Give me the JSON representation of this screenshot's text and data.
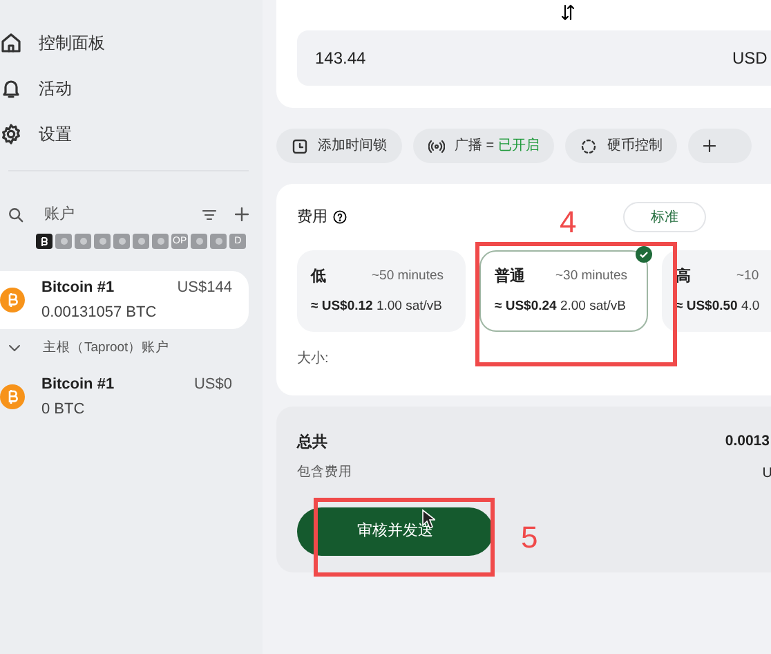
{
  "sidebar": {
    "nav": [
      {
        "kind": "home",
        "label": "控制面板"
      },
      {
        "kind": "bell",
        "label": "活动"
      },
      {
        "kind": "gear",
        "label": "设置"
      }
    ],
    "accounts_header": {
      "label": "账户"
    },
    "chains": [
      {
        "selected": true,
        "kind": "bitcoin"
      },
      {
        "selected": false,
        "kind": "blank"
      },
      {
        "selected": false,
        "kind": "blank"
      },
      {
        "selected": false,
        "kind": "blank"
      },
      {
        "selected": false,
        "kind": "blank"
      },
      {
        "selected": false,
        "kind": "blank"
      },
      {
        "selected": false,
        "kind": "blank"
      },
      {
        "selected": false,
        "kind": "text",
        "label": "OP"
      },
      {
        "selected": false,
        "kind": "blank"
      },
      {
        "selected": false,
        "kind": "blank"
      },
      {
        "selected": false,
        "kind": "text",
        "label": "D"
      }
    ],
    "accounts": [
      {
        "name": "Bitcoin #1",
        "fiat": "US$144",
        "amount": "0.00131057 BTC",
        "selected": true
      }
    ],
    "group": {
      "label": "主根（Taproot）账户",
      "expanded": true,
      "accounts": [
        {
          "name": "Bitcoin #1",
          "fiat": "US$0",
          "amount": "0 BTC",
          "selected": false
        }
      ]
    }
  },
  "amount": {
    "value": "143.44",
    "currency": "USD"
  },
  "chips": [
    {
      "kind": "timelock",
      "label": "添加时间锁"
    },
    {
      "kind": "broadcast",
      "label": "广播 =",
      "value": "已开启"
    },
    {
      "kind": "coins",
      "label": "硬币控制"
    },
    {
      "kind": "plus"
    }
  ],
  "fee": {
    "title": "费用",
    "mode": "标准",
    "options": [
      {
        "label": "低",
        "eta": "~50 minutes",
        "price": "≈ US$0.12",
        "rate": "1.00 sat/vB",
        "selected": false
      },
      {
        "label": "普通",
        "eta": "~30 minutes",
        "price": "≈ US$0.24",
        "rate": "2.00 sat/vB",
        "selected": true
      },
      {
        "label": "高",
        "eta": "~10",
        "price": "≈ US$0.50",
        "rate": "4.0",
        "selected": false
      }
    ],
    "size_label": "大小:"
  },
  "total": {
    "label": "总共",
    "value": "0.0013",
    "sub_label": "包含费用",
    "sub_value": "U"
  },
  "submit": {
    "label": "审核并发送"
  },
  "annotations": [
    {
      "number": "4"
    },
    {
      "number": "5"
    }
  ]
}
